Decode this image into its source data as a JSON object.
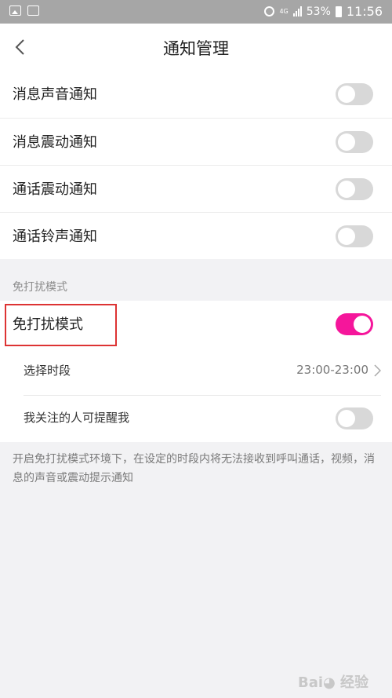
{
  "status_bar": {
    "network": "4G",
    "battery": "53%",
    "time": "11:56"
  },
  "header": {
    "title": "通知管理"
  },
  "notification_settings": [
    {
      "label": "消息声音通知",
      "enabled": false
    },
    {
      "label": "消息震动通知",
      "enabled": false
    },
    {
      "label": "通话震动通知",
      "enabled": false
    },
    {
      "label": "通话铃声通知",
      "enabled": false
    }
  ],
  "dnd_section": {
    "header": "免打扰模式",
    "main_toggle": {
      "label": "免打扰模式",
      "enabled": true
    },
    "time_period": {
      "label": "选择时段",
      "value": "23:00-23:00"
    },
    "followed_remind": {
      "label": "我关注的人可提醒我",
      "enabled": false
    },
    "footnote": "开启免打扰模式环境下，在设定的时段内将无法接收到呼叫通话，视频，消息的声音或震动提示通知"
  },
  "colors": {
    "accent": "#f5169b",
    "toggle_off": "#d8d8d8",
    "highlight_box": "#dd3333"
  }
}
